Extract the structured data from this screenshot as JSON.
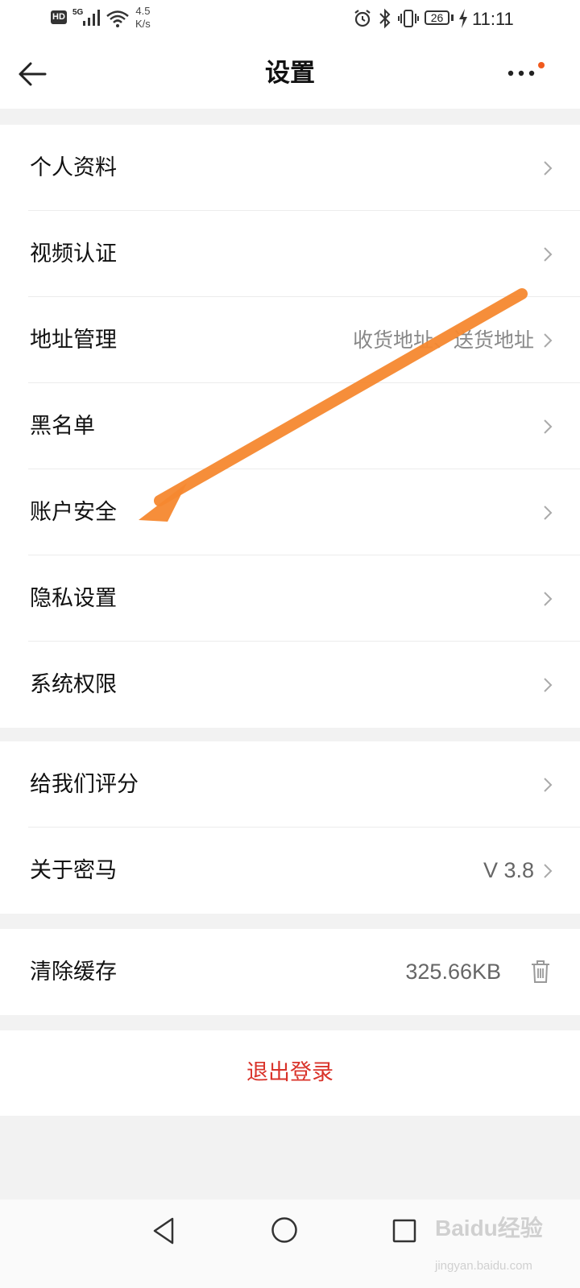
{
  "status_bar": {
    "hd": "HD",
    "network": "5G",
    "speed_value": "4.5",
    "speed_unit": "K/s",
    "battery": "26",
    "time": "11:11"
  },
  "header": {
    "title": "设置"
  },
  "groups": [
    {
      "items": [
        {
          "label": "个人资料",
          "value": ""
        },
        {
          "label": "视频认证",
          "value": ""
        },
        {
          "label": "地址管理",
          "value": "收货地址、送货地址"
        },
        {
          "label": "黑名单",
          "value": ""
        },
        {
          "label": "账户安全",
          "value": ""
        },
        {
          "label": "隐私设置",
          "value": ""
        },
        {
          "label": "系统权限",
          "value": ""
        }
      ]
    },
    {
      "items": [
        {
          "label": "给我们评分",
          "value": ""
        },
        {
          "label": "关于密马",
          "value": "V 3.8"
        }
      ]
    },
    {
      "items": [
        {
          "label": "清除缓存",
          "value": "325.66KB"
        }
      ]
    }
  ],
  "logout_label": "退出登录",
  "watermark": {
    "brand": "Baidu经验",
    "url": "jingyan.baidu.com"
  },
  "colors": {
    "logout_red": "#d9332a",
    "annotation_orange": "#f5882f",
    "notification_dot": "#f05a1e"
  },
  "icons": {
    "back": "arrow-left-icon",
    "more": "more-dots-icon",
    "chevron": "chevron-right-icon",
    "trash": "trash-icon"
  }
}
